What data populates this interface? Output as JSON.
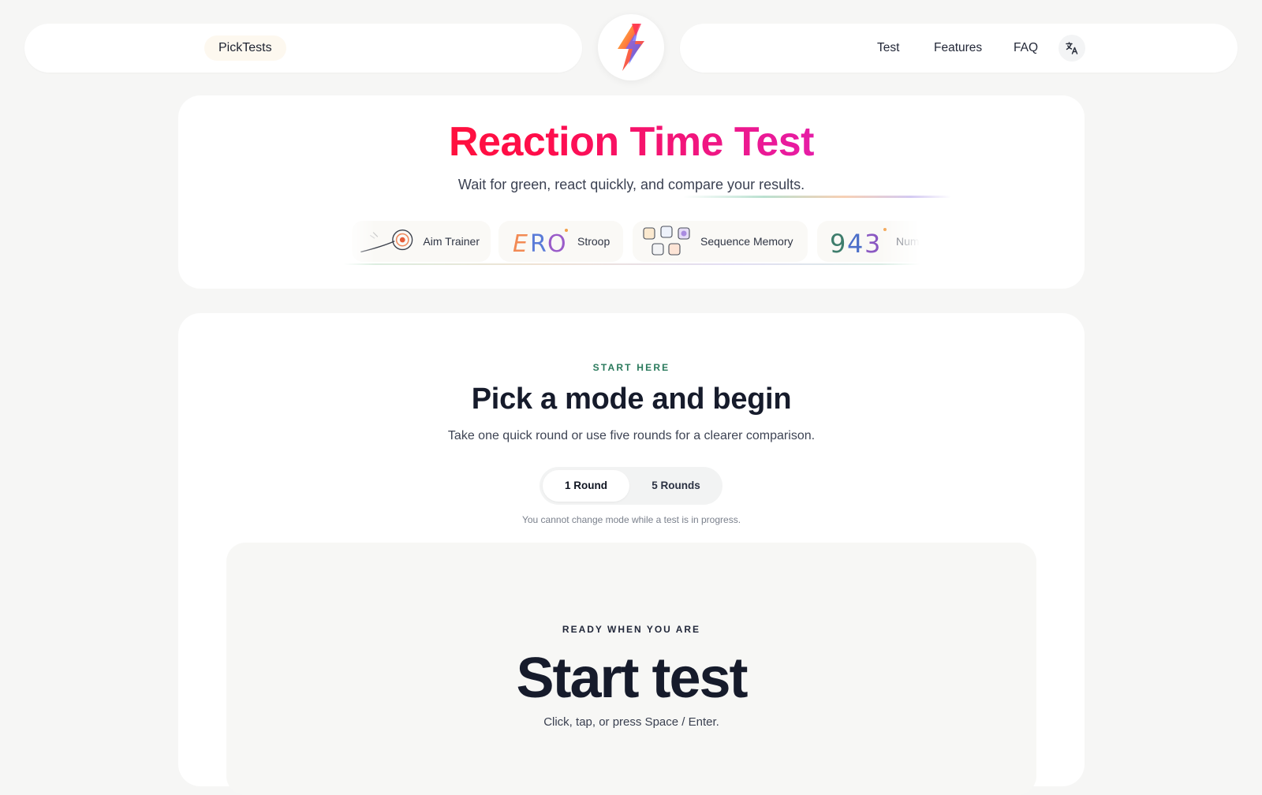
{
  "header": {
    "brand": "PickTests",
    "nav": [
      {
        "label": "Test"
      },
      {
        "label": "Features"
      },
      {
        "label": "FAQ"
      }
    ],
    "logo_icon": "lightning-bolt-icon",
    "language_icon": "translate-icon"
  },
  "hero": {
    "title": "Reaction Time Test",
    "subtitle": "Wait for green, react quickly, and compare your results.",
    "related_tests": [
      {
        "label": "Aim Trainer",
        "icon": "target-icon"
      },
      {
        "label": "Stroop",
        "icon": "stroop-icon"
      },
      {
        "label": "Sequence Memory",
        "icon": "grid-squares-icon"
      },
      {
        "label": "Numb",
        "icon": "number-icon"
      }
    ]
  },
  "main": {
    "kicker": "START HERE",
    "title": "Pick a mode and begin",
    "subtitle": "Take one quick round or use five rounds for a clearer comparison.",
    "modes": [
      {
        "label": "1 Round",
        "selected": true
      },
      {
        "label": "5 Rounds",
        "selected": false
      }
    ],
    "mode_note": "You cannot change mode while a test is in progress.",
    "test": {
      "kicker": "READY WHEN YOU ARE",
      "title": "Start test",
      "hint": "Click, tap, or press Space / Enter."
    }
  },
  "colors": {
    "page_bg": "#f6f6f5",
    "card_bg": "#ffffff",
    "title_gradient_start": "#ff1a1a",
    "title_gradient_end": "#c81ee0",
    "kicker_green": "#2a7a5c",
    "text_dark": "#161b2b"
  }
}
